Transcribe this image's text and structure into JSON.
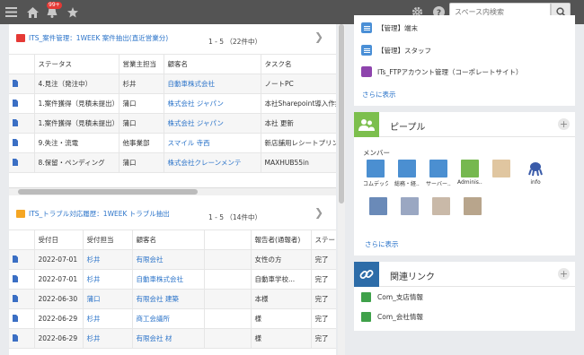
{
  "topbar": {
    "notification_badge": "99+",
    "search_placeholder": "スペース内検索",
    "icons": [
      "menu-icon",
      "home-icon",
      "bell-icon",
      "star-icon",
      "gear-icon",
      "help-icon",
      "search-icon"
    ]
  },
  "case_list": {
    "title": "ITS_案件管理：1WEEK 案件抽出(直近営業分)",
    "pager": "1 - 5 （22件中）",
    "columns": [
      "",
      "ステータス",
      "営業主担当",
      "顧客名",
      "タスク名"
    ],
    "rows": [
      {
        "status": "4.見注（発注中）",
        "owner": "杉井",
        "customer": "自動車株式会社",
        "task": "ノートPC"
      },
      {
        "status": "1.案件獲得（見積未提出）",
        "owner": "蒲口",
        "customer": "株式会社 ジャパン",
        "task": "本社Sharepoint導入作業"
      },
      {
        "status": "1.案件獲得（見積未提出）",
        "owner": "蒲口",
        "customer": "株式会社 ジャパン",
        "task": "本社 更新"
      },
      {
        "status": "9.失注・流電",
        "owner": "他事業部",
        "customer": "スマイル 寺西",
        "task": "新店舗用レシートプリンタ"
      },
      {
        "status": "8.保留・ペンディング",
        "owner": "蒲口",
        "customer": "株式会社クレーンメンテ",
        "task": "MAXHUB55in"
      }
    ]
  },
  "trouble_list": {
    "title": "ITS_トラブル対応履歴：1WEEK トラブル抽出",
    "pager": "1 - 5 （14件中）",
    "columns": [
      "",
      "受付日",
      "受付担当",
      "顧客名",
      "",
      "報告者(通報者)",
      "ステー"
    ],
    "rows": [
      {
        "date": "2022-07-01",
        "staff": "杉井",
        "customer": "有限会社",
        "reporter": "女性の方",
        "status": "完了"
      },
      {
        "date": "2022-07-01",
        "staff": "杉井",
        "customer": "自動車株式会社",
        "reporter": "自動車学校...",
        "status": "完了"
      },
      {
        "date": "2022-06-30",
        "staff": "蒲口",
        "customer": "有限会社 建築",
        "reporter": "本様",
        "status": "完了"
      },
      {
        "date": "2022-06-29",
        "staff": "杉井",
        "customer": "商工会議所",
        "reporter": "様",
        "status": "完了"
      },
      {
        "date": "2022-06-29",
        "staff": "杉井",
        "customer": "有限会社 材",
        "reporter": "様",
        "status": "完了"
      }
    ]
  },
  "apps": {
    "items": [
      "【管理】端末",
      "【管理】スタッフ",
      "ITs_FTPアカウント管理（コーポレートサイト）"
    ],
    "more": "さらに表示"
  },
  "people": {
    "title": "ピープル",
    "members_label": "メンバー",
    "members": [
      {
        "name": "コムデック",
        "color": "#4b8fd1"
      },
      {
        "name": "総務・経...",
        "color": "#4b8fd1"
      },
      {
        "name": "サーバー...",
        "color": "#4b8fd1"
      },
      {
        "name": "Adminis...",
        "color": "#76b84f"
      },
      {
        "name": "",
        "color": "#e0c6a0"
      },
      {
        "name": "info",
        "color": "#ffffff"
      },
      {
        "name": "",
        "color": "#6a8ab8"
      },
      {
        "name": "",
        "color": "#9aa7c2"
      },
      {
        "name": "",
        "color": "#c9b9a8"
      },
      {
        "name": "",
        "color": "#b8a58c"
      }
    ],
    "more": "さらに表示"
  },
  "links": {
    "title": "関連リンク",
    "items": [
      "Com_支店情報",
      "Com_会社情報"
    ]
  }
}
